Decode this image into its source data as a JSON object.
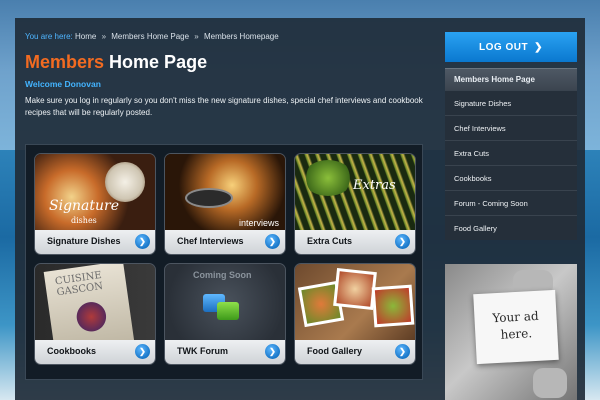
{
  "breadcrumb": {
    "lead": "You are here:",
    "items": [
      "Home",
      "Members Home Page",
      "Members Homepage"
    ],
    "separator": "»"
  },
  "page": {
    "title_accent": "Members",
    "title_rest": "Home Page",
    "welcome": "Welcome Donovan",
    "intro": "Make sure you log in regularly so you don't miss the new signature dishes, special chef interviews and cookbook recipes that will be regularly posted."
  },
  "tiles": [
    {
      "label": "Signature Dishes",
      "art_text": "Signature",
      "art_subtext": "dishes",
      "icon": "chevron-right-icon"
    },
    {
      "label": "Chef Interviews",
      "art_text": "interviews",
      "icon": "chevron-right-icon"
    },
    {
      "label": "Extra Cuts",
      "art_text": "Extras",
      "icon": "chevron-right-icon"
    },
    {
      "label": "Cookbooks",
      "art_text": "CUISINE GASCON",
      "icon": "chevron-right-icon"
    },
    {
      "label": "TWK Forum",
      "art_text": "Coming Soon",
      "icon": "chevron-right-icon"
    },
    {
      "label": "Food Gallery",
      "icon": "chevron-right-icon"
    }
  ],
  "sidebar": {
    "logout_label": "LOG OUT",
    "logout_icon": "chevron-right-icon",
    "menu_title": "Members Home Page",
    "menu_items": [
      "Signature Dishes",
      "Chef Interviews",
      "Extra Cuts",
      "Cookbooks",
      "Forum - Coming Soon",
      "Food Gallery"
    ],
    "ad_text": [
      "Your ad",
      "here."
    ]
  },
  "colors": {
    "accent_orange": "#f26b21",
    "link_blue": "#43b4ff",
    "button_blue": "#0a78cf"
  }
}
